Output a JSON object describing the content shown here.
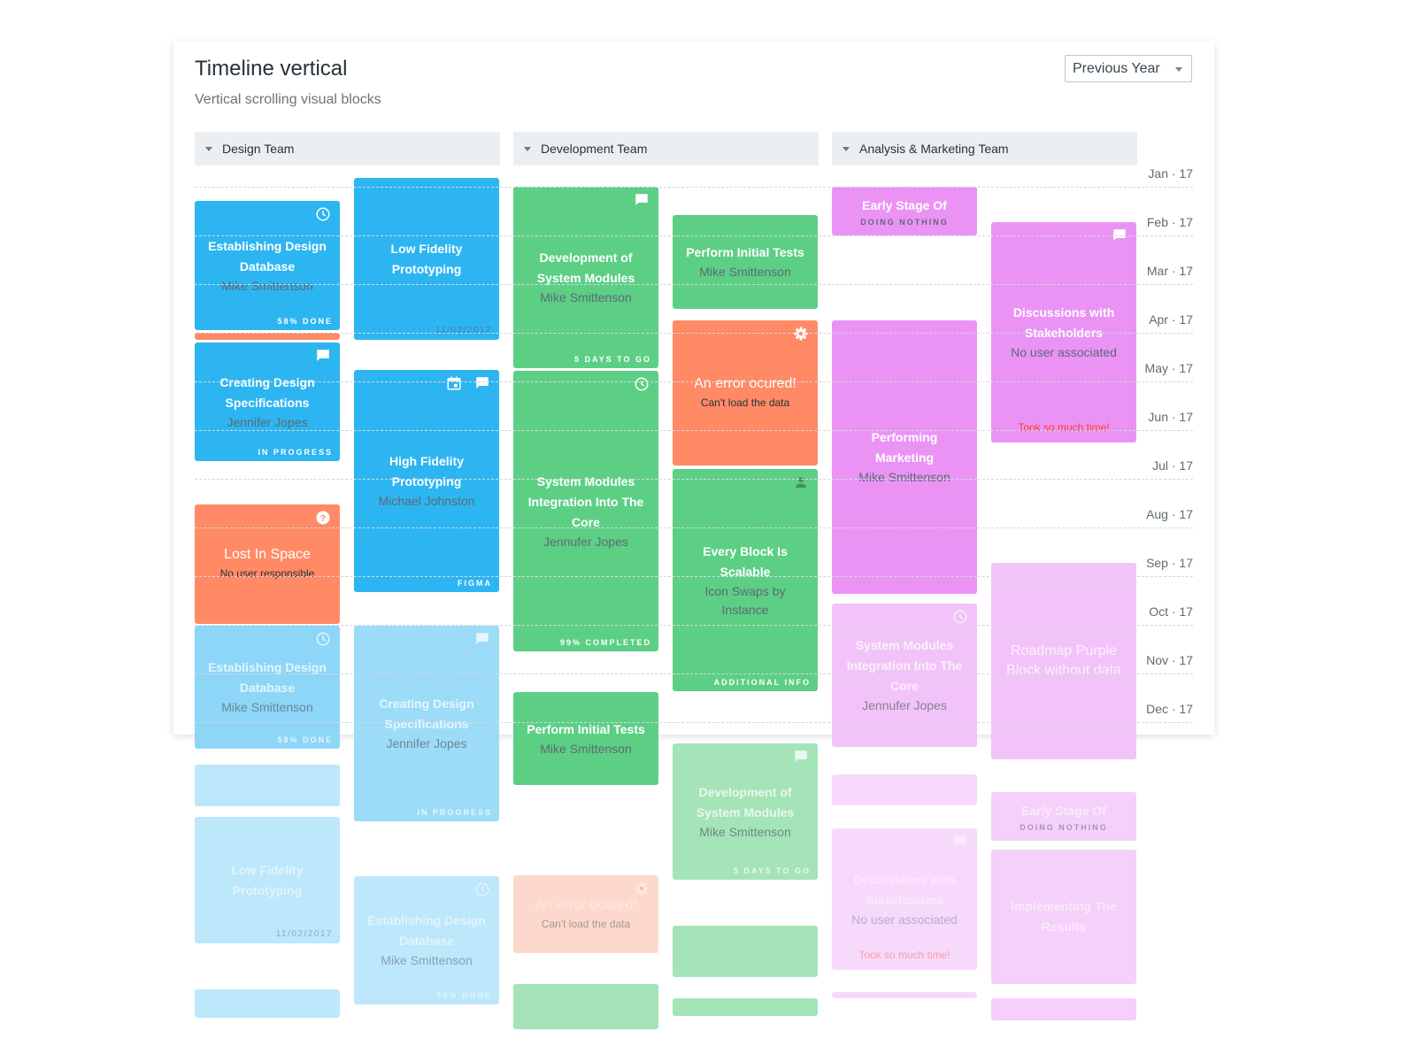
{
  "header": {
    "title": "Timeline vertical",
    "subtitle": "Vertical scrolling visual blocks",
    "period_select": "Previous Year"
  },
  "groups": [
    {
      "label": "Design Team"
    },
    {
      "label": "Development Team"
    },
    {
      "label": "Analysis & Marketing Team"
    }
  ],
  "months": [
    "Jan · 17",
    "Feb · 17",
    "Mar · 17",
    "Apr · 17",
    "May · 17",
    "Jun · 17",
    "Jul · 17",
    "Aug · 17",
    "Sep · 17",
    "Oct · 17",
    "Nov · 17",
    "Dec · 17"
  ],
  "colors": {
    "blue": "#2db5f2",
    "orange": "#ff8a65",
    "green": "#5ccf85",
    "purple": "#ea93f5",
    "header_bg": "#eceff1"
  },
  "cards": [
    {
      "title": "Establishing Design Database",
      "sub": "Mike Smittenson",
      "footer": "58% DONE",
      "icons": [
        "clock"
      ]
    },
    {
      "title": "",
      "sub": "",
      "footer": "",
      "icons": []
    },
    {
      "title": "Creating Design Specifications",
      "sub": "Jennifer Jopes",
      "footer": "IN PROGRESS",
      "icons": [
        "comment"
      ]
    },
    {
      "title": "Lost In Space",
      "sub": "No user responsible",
      "footer": "",
      "icons": [
        "question"
      ]
    },
    {
      "title": "Establishing Design Database",
      "sub": "Mike Smittenson",
      "footer": "58% DONE",
      "icons": [
        "clock"
      ]
    },
    {
      "title": "",
      "sub": "",
      "footer": "",
      "icons": []
    },
    {
      "title": "Low Fidelity Prototyping",
      "sub": "",
      "footer": "11/02/2017",
      "icons": []
    },
    {
      "title": "",
      "sub": "",
      "footer": "",
      "icons": []
    },
    {
      "title": "Low Fidelity Prototyping",
      "sub": "",
      "footer": "11/02/2017",
      "icons": []
    },
    {
      "title": "High Fidelity Prototyping",
      "sub": "Michael Johnston",
      "footer": "FIGMA",
      "icons": [
        "calendar",
        "comment"
      ]
    },
    {
      "title": "Creating Design Specifications",
      "sub": "Jennifer Jopes",
      "footer": "IN PROGRESS",
      "icons": [
        "comment"
      ]
    },
    {
      "title": "Establishing Design Database",
      "sub": "Mike Smittenson",
      "footer": "58% DONE",
      "icons": [
        "clock"
      ]
    },
    {
      "title": "Development of System Modules",
      "sub": "Mike Smittenson",
      "footer": "5 DAYS TO GO",
      "icons": [
        "comment"
      ]
    },
    {
      "title": "System Modules Integration Into The Core",
      "sub": "Jennufer Jopes",
      "footer": "99% COMPLETED",
      "icons": [
        "clock"
      ]
    },
    {
      "title": "Perform Initial Tests",
      "sub": "Mike Smittenson",
      "footer": "",
      "icons": []
    },
    {
      "title": "An error ocured!",
      "sub": "Can't load the data",
      "footer": "",
      "icons": [
        "gear"
      ]
    },
    {
      "title": "",
      "sub": "",
      "footer": "",
      "icons": []
    },
    {
      "title": "Perform Initial Tests",
      "sub": "Mike Smittenson",
      "footer": "",
      "icons": []
    },
    {
      "title": "An error ocured!",
      "sub": "Can't load the data",
      "footer": "",
      "icons": [
        "gear"
      ]
    },
    {
      "title": "Every Block Is Scalable",
      "sub": "Icon Swaps by Instance",
      "footer": "ADDITIONAL INFO",
      "icons": [
        "person"
      ]
    },
    {
      "title": "Development of System Modules",
      "sub": "Mike Smittenson",
      "footer": "5 DAYS TO GO",
      "icons": [
        "comment"
      ]
    },
    {
      "title": "",
      "sub": "",
      "footer": "",
      "icons": []
    },
    {
      "title": "",
      "sub": "",
      "footer": "",
      "icons": []
    },
    {
      "title": "Early Stage Of",
      "caps": "DOING NOTHING",
      "footer": "",
      "icons": []
    },
    {
      "title": "Performing Marketing",
      "sub": "Mike Smittenson",
      "footer": "",
      "icons": []
    },
    {
      "title": "System Modules Integration Into The Core",
      "sub": "Jennufer Jopes",
      "footer": "",
      "icons": [
        "clock"
      ]
    },
    {
      "title": "",
      "sub": "",
      "footer": "",
      "icons": []
    },
    {
      "title": "Discussions with Stakeholders",
      "sub": "No user associated",
      "note": "Took so much time!",
      "icons": [
        "comment"
      ]
    },
    {
      "title": "",
      "sub": "",
      "footer": "",
      "icons": []
    },
    {
      "title": "Discussions with Stakeholders",
      "sub": "No user associated",
      "note": "Took so much time!",
      "icons": [
        "comment"
      ]
    },
    {
      "title": "Roadmap Purple Block without data",
      "sub": "",
      "footer": "",
      "icons": []
    },
    {
      "title": "Early Stage Of",
      "caps": "DOING NOTHING",
      "footer": "",
      "icons": []
    },
    {
      "title": "Implementing The Results",
      "sub": "",
      "footer": "",
      "icons": []
    },
    {
      "title": "",
      "sub": "",
      "footer": "",
      "icons": []
    }
  ]
}
